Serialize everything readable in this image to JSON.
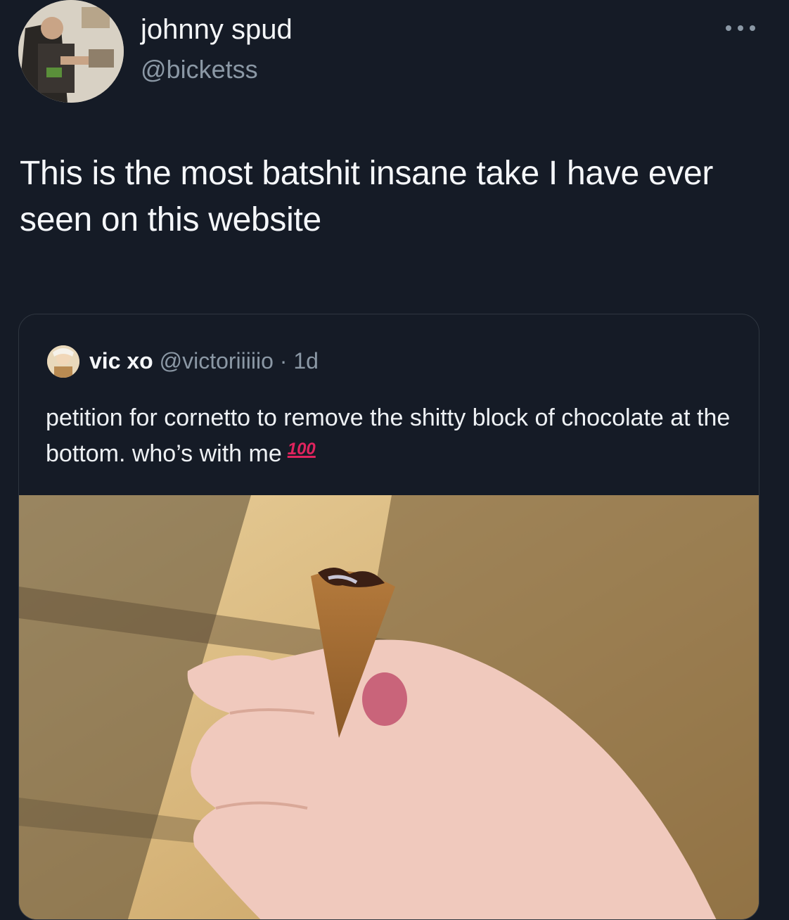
{
  "author": {
    "name": "johnny spud",
    "handle": "@bicketss"
  },
  "tweet": {
    "text": "This is the most batshit insane take I have ever seen on this website"
  },
  "quoted": {
    "name": "vic xo",
    "handle": "@victoriiiiio",
    "separator": "·",
    "time": "1d",
    "text": "petition for cornetto to remove the shitty block of chocolate at the bottom. who’s with me",
    "emoji": "100"
  },
  "colors": {
    "background": "#151b26",
    "text_primary": "#f5f7fa",
    "text_secondary": "#8b98a5",
    "border": "#2f3640",
    "emoji_red": "#e0245e"
  },
  "icons": {
    "more": "more-horizontal-icon"
  }
}
